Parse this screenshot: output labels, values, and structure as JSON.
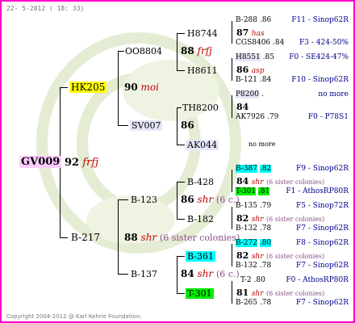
{
  "date_text": "22- 5-2012 ( 18: 33)",
  "copyright": "Copyright 2004-2012 @ Karl Kehrle Foundation.",
  "queen": {
    "id": "GV009",
    "num": "92",
    "year": "frfj"
  },
  "g1": {
    "top": {
      "id": "HK205",
      "num": "90",
      "year": "moi"
    },
    "bot": {
      "id": "B-217",
      "num": "88",
      "year": "shr",
      "note": "(6 sister colonies)"
    }
  },
  "g2": [
    {
      "id": "OO8804",
      "num": "88",
      "year": "frfj"
    },
    {
      "id": "SV007",
      "num": "86",
      "year": ""
    },
    {
      "id": "B-123",
      "num": "86",
      "year": "shr",
      "note": "(6 c.)"
    },
    {
      "id": "B-137",
      "num": "84",
      "year": "shr",
      "note": "(6 c.)"
    }
  ],
  "g3": [
    {
      "id": "H8744",
      "num": "87",
      "year": "has"
    },
    {
      "id": "H8611",
      "num": "86",
      "year": "asp"
    },
    {
      "id": "TH8200",
      "num": "84",
      "year": ""
    },
    {
      "id": "AK044",
      "num": "",
      "year": "",
      "note": "no more"
    },
    {
      "id": "B-428",
      "num": "84",
      "year": "shr",
      "note": "(6 sister colonies)"
    },
    {
      "id": "B-182",
      "num": "82",
      "year": "shr",
      "note": "(6 sister colonies)"
    },
    {
      "id": "B-361",
      "num": "82",
      "year": "shr",
      "note": "(6 sister colonies)"
    },
    {
      "id": "T-301",
      "num": "81",
      "year": "shr",
      "note": "(6 sister colonies)"
    }
  ],
  "g4": [
    {
      "id": "B-288",
      "val": ".86",
      "src": "F11 - Sinop62R"
    },
    {
      "id": "CGS8406",
      "val": ".84",
      "src": "F3 - 424-50%"
    },
    {
      "id": "H8551",
      "val": ".85",
      "src": "F0 - SE424-47%"
    },
    {
      "id": "B-121",
      "val": ".84",
      "src": "F10 - Sinop62R"
    },
    {
      "id": "P8200",
      "val": ".",
      "src": "no more"
    },
    {
      "id": "AK7926",
      "val": ".79",
      "src": "F0 - P78S1"
    },
    {
      "id": "B-387",
      "val": ".82",
      "src": "F9 - Sinop62R"
    },
    {
      "id": "T-301",
      "val": ".81",
      "src": "F1 - AthosRP80R"
    },
    {
      "id": "B-135",
      "val": ".79",
      "src": "F5 - Sinop72R"
    },
    {
      "id": "B-132",
      "val": ".78",
      "src": "F7 - Sinop62R"
    },
    {
      "id": "B-272",
      "val": ".80",
      "src": "F8 - Sinop62R"
    },
    {
      "id": "B-132",
      "val": ".78",
      "src": "F7 - Sinop62R"
    },
    {
      "id": "T-2",
      "val": ".80",
      "src": "F0 - AthosRP80R"
    },
    {
      "id": "B-265",
      "val": ".78",
      "src": "F7 - Sinop62R"
    }
  ]
}
